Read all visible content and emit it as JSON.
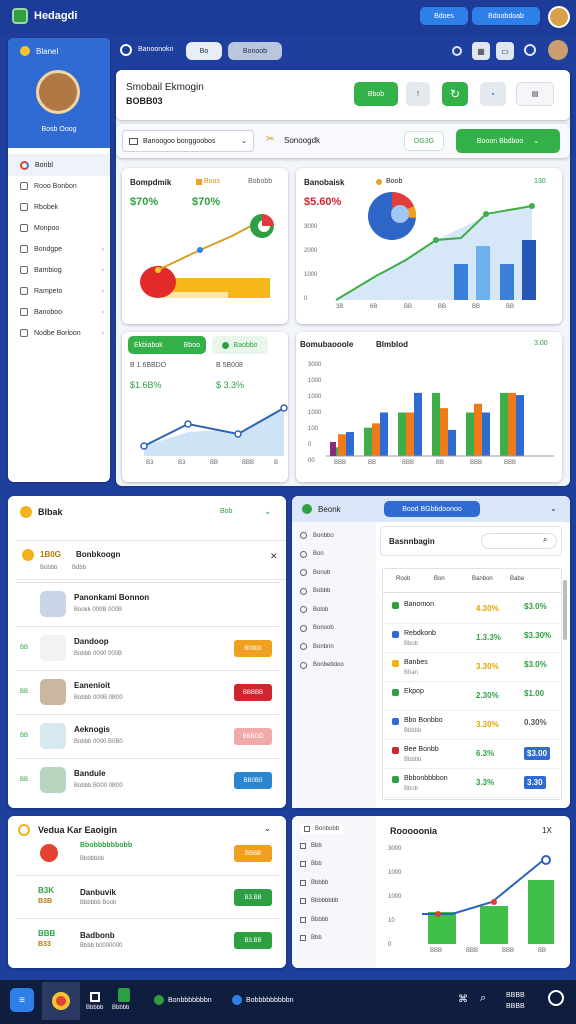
{
  "app": {
    "logo_text": "Hedagdi"
  },
  "topbar": {
    "btn1": "Bdoes",
    "btn2": "Bdoobdoab"
  },
  "sidebar": {
    "header": "Blanel",
    "user_name": "Bosb Ooog",
    "active": "Bonbl",
    "items": [
      {
        "label": "Rooo Bonbon",
        "chev": false
      },
      {
        "label": "Rbobek",
        "chev": false
      },
      {
        "label": "Monpoo",
        "chev": false
      },
      {
        "label": "Bondgpe",
        "chev": true
      },
      {
        "label": "Bambiog",
        "chev": true
      },
      {
        "label": "Rampeto",
        "chev": true
      },
      {
        "label": "Banoboo",
        "chev": true
      },
      {
        "label": "Nodbe Borloon",
        "chev": true
      }
    ]
  },
  "toolbar": {
    "search_label": "Banoonokn",
    "tab1": "Bo",
    "tab2": "Bonoob"
  },
  "header_card": {
    "title": "Smobail Ekmogin",
    "subtitle": "BOBB03",
    "primary_btn": "Bbob"
  },
  "filter": {
    "select_value": "Banoogoo bonggoobos",
    "label": "Sonoogdk",
    "value": "OG3G",
    "action": "Booon Bbdboo"
  },
  "card1": {
    "title": "Bompdmik",
    "legend": "Boos",
    "legend2": "Bobobb",
    "v1": "$70%",
    "v2": "$70%"
  },
  "card2": {
    "title": "Banobaisk",
    "legend": "Boob",
    "legend2": "130",
    "value": "$5.60%",
    "yticks": [
      "3000",
      "2000",
      "1000",
      "0"
    ],
    "xticks": [
      "3B",
      "6B",
      "BB",
      "BB",
      "BB",
      "BB"
    ]
  },
  "card3": {
    "tab1": "Ekbiabok",
    "tab1b": "Bboo",
    "tab2": "Baobbo",
    "l1a": "B 1.6BBDO",
    "l1b": "$1.6B%",
    "r1a": "B 5B008",
    "r1b": "$ 3.3%",
    "xticks": [
      "B3",
      "B3",
      "BB",
      "BBB",
      "B"
    ]
  },
  "card4": {
    "title": "Bomubaooole",
    "title2": "Blmblod",
    "legend": "3.00",
    "yticks": [
      "3000",
      "1000",
      "1000",
      "1000",
      "100",
      "0",
      "00"
    ],
    "xticks": [
      "BBB",
      "BB",
      "BBB",
      "BB",
      "BBB",
      "BBB"
    ]
  },
  "chart_data": {
    "type": "bar",
    "categories": [
      "BBB",
      "BB",
      "BBB",
      "BB",
      "BBB",
      "BBB"
    ],
    "series": [
      {
        "name": "",
        "values": [
          200,
          650,
          1000,
          1450,
          1000,
          1450
        ]
      },
      {
        "name": "",
        "values": [
          500,
          750,
          1000,
          1100,
          1200,
          1450
        ]
      },
      {
        "name": "",
        "values": [
          550,
          1000,
          1450,
          600,
          1000,
          1400
        ]
      }
    ],
    "ylim": [
      0,
      1700
    ]
  },
  "panel_people": {
    "title": "Blbak",
    "badge": "Bob",
    "search_count": "1B0G",
    "search_title": "Bonbkoogn",
    "sub1": "Bobbb",
    "sub2": "Bdbb",
    "rows": [
      {
        "name": "Panonkami Bonnon",
        "sub": "Bookk 000B 000B",
        "badge": "",
        "color": "",
        "dot": ""
      },
      {
        "name": "Dandoop",
        "sub": "Bobbb 0000 000B",
        "badge": "B0000",
        "color": "#f0a020",
        "dot": "BB"
      },
      {
        "name": "Eanenioit",
        "sub": "Bobbb 000B 0B00",
        "badge": "BBBBB",
        "color": "#d0262e",
        "dot": "BB"
      },
      {
        "name": "Aeknogis",
        "sub": "Bobbb 0000 B0B0",
        "badge": "BBBOD",
        "color": "#f2a9a9",
        "dot": "BB"
      },
      {
        "name": "Bandule",
        "sub": "Bobbb B000 0B00",
        "badge": "BB0B0",
        "color": "#2a87cf",
        "dot": "BB"
      }
    ]
  },
  "panel_table": {
    "title": "Beonk",
    "header_btn": "Bood BGbbdoonoo",
    "nav": [
      "Bonbbo",
      "Bon",
      "Bonob",
      "Bobbb",
      "Bolob",
      "Bonoob",
      "Bonbnn",
      "Bonbebdoo"
    ],
    "search_title": "Basnnbagin",
    "cols": [
      "Roob",
      "Bon",
      "Banbon",
      "Baba"
    ],
    "rows": [
      {
        "name": "Banomon",
        "sub": "",
        "pct": "4.30%",
        "val": "$3.0%",
        "pct_color": "#e0a800",
        "val_color": "#2ea043"
      },
      {
        "name": "Rebdkonb",
        "sub": "Bbob",
        "pct": "1.3.3%",
        "val": "$3.30%",
        "pct_color": "#2ea043",
        "val_color": "#2ea043"
      },
      {
        "name": "Banbes",
        "sub": "Bhan",
        "pct": "3.30%",
        "val": "$3.0%",
        "pct_color": "#e0a800",
        "val_color": "#2ea043"
      },
      {
        "name": "Ekpop",
        "sub": "",
        "pct": "2.30%",
        "val": "$1.00",
        "pct_color": "#2ea043",
        "val_color": "#2ea043"
      },
      {
        "name": "Bbo Bonbbo",
        "sub": "Bbbbb",
        "pct": "3.30%",
        "val": "0.30%",
        "pct_color": "#e0a800",
        "val_color": "#555"
      },
      {
        "name": "Bee Bonbb",
        "sub": "Bbbbb",
        "pct": "6.3%",
        "val": "$3.00",
        "pct_color": "#2ea043",
        "val_color": "#fff"
      },
      {
        "name": "Bbbonbbbbon",
        "sub": "Bbob",
        "pct": "3.3%",
        "val": "3.30",
        "pct_color": "#2ea043",
        "val_color": "#fff"
      }
    ]
  },
  "panel_bottom_left": {
    "title": "Vedua Kar Eaoigin",
    "rows": [
      {
        "top": "",
        "top2": "",
        "name": "Bbobbbbbbobb",
        "sub": "Bbdbbbb",
        "badge": "BBBB",
        "color": "#f0a020"
      },
      {
        "top": "B3K",
        "top2": "B3B",
        "name": "Danbuvik",
        "sub": "Bbbbbb Boob",
        "badge": "B3.BB",
        "color": "#2ea043"
      },
      {
        "top": "BBB",
        "top2": "B33",
        "name": "Badbonb",
        "sub": "Bbbb b0000000",
        "badge": "B3.BB",
        "color": "#2ea043"
      }
    ]
  },
  "panel_bottom_right": {
    "nav": [
      "Bonbobb",
      "Bbb",
      "Bbb",
      "Bbbbb",
      "Bbbbbbbb",
      "Bbbbb",
      "Bbb"
    ],
    "title": "Rooooonia",
    "ctrl": "1X",
    "yticks": [
      "3000",
      "1000",
      "1000",
      "10",
      "0"
    ],
    "xticks": [
      "BBB",
      "BBB",
      "BBB",
      "BB"
    ]
  },
  "taskbar": {
    "app1": "Bbbbb",
    "app2": "Bbbbb",
    "app3": "Bonbbbbbbbn",
    "app4": "Bobbbbbbbbbn",
    "clock": "BBBB",
    "date": "BBBB"
  }
}
